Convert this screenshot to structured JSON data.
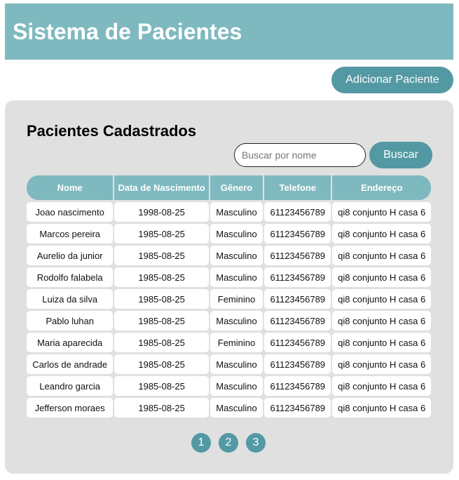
{
  "header": {
    "title": "Sistema de Pacientes"
  },
  "actions": {
    "add_label": "Adicionar Paciente"
  },
  "panel": {
    "title": "Pacientes Cadastrados",
    "search_placeholder": "Buscar por nome",
    "search_value": "",
    "search_label": "Buscar"
  },
  "table": {
    "headers": [
      "Nome",
      "Data de Nascimento",
      "Gênero",
      "Telefone",
      "Endereço"
    ],
    "rows": [
      [
        "Joao nascimento",
        "1998-08-25",
        "Masculino",
        "61123456789",
        "qi8 conjunto H casa 6"
      ],
      [
        "Marcos pereira",
        "1985-08-25",
        "Masculino",
        "61123456789",
        "qi8 conjunto H casa 6"
      ],
      [
        "Aurelio da junior",
        "1985-08-25",
        "Masculino",
        "61123456789",
        "qi8 conjunto H casa 6"
      ],
      [
        "Rodolfo falabela",
        "1985-08-25",
        "Masculino",
        "61123456789",
        "qi8 conjunto H casa 6"
      ],
      [
        "Luiza da silva",
        "1985-08-25",
        "Feminino",
        "61123456789",
        "qi8 conjunto H casa 6"
      ],
      [
        "Pablo luhan",
        "1985-08-25",
        "Masculino",
        "61123456789",
        "qi8 conjunto H casa 6"
      ],
      [
        "Maria aparecida",
        "1985-08-25",
        "Feminino",
        "61123456789",
        "qi8 conjunto H casa 6"
      ],
      [
        "Carlos de andrade",
        "1985-08-25",
        "Masculino",
        "61123456789",
        "qi8 conjunto H casa 6"
      ],
      [
        "Leandro garcia",
        "1985-08-25",
        "Masculino",
        "61123456789",
        "qi8 conjunto H casa 6"
      ],
      [
        "Jefferson moraes",
        "1985-08-25",
        "Masculino",
        "61123456789",
        "qi8 conjunto H casa 6"
      ]
    ]
  },
  "pagination": {
    "pages": [
      "1",
      "2",
      "3"
    ]
  },
  "colors": {
    "header_bg": "#7fb9c0",
    "button_bg": "#5399a3",
    "panel_bg": "#e0e0e0",
    "text_light": "#ffffff"
  }
}
